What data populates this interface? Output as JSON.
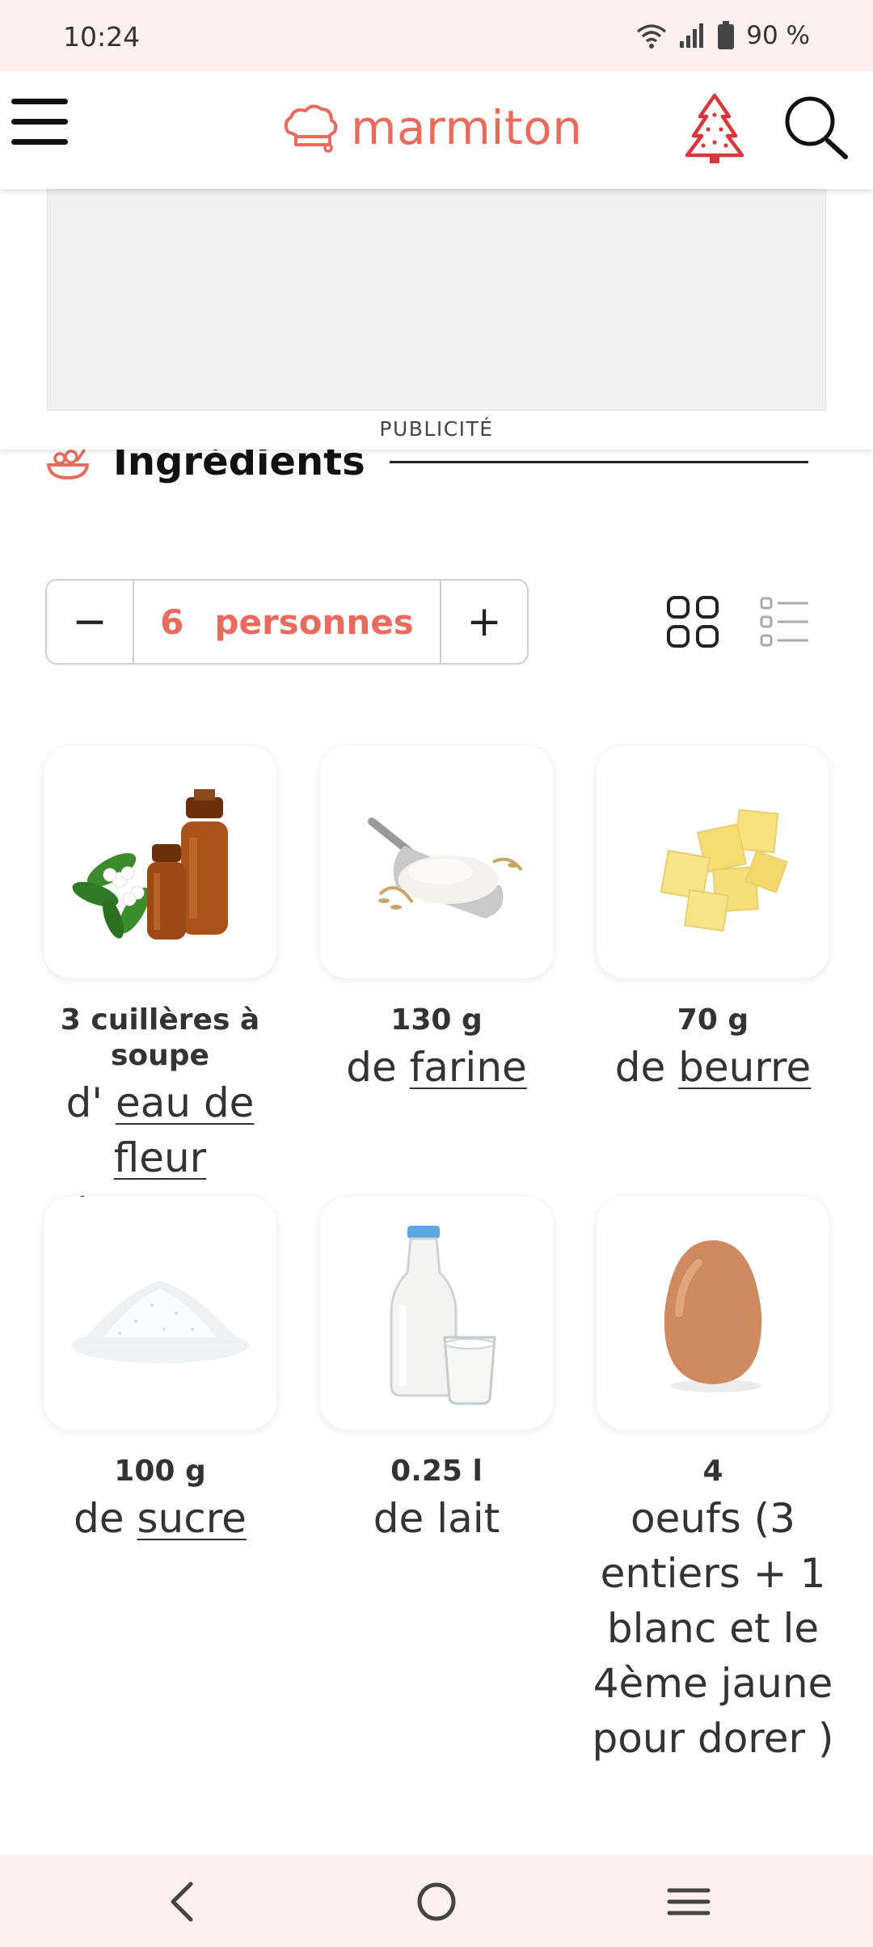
{
  "status_bar": {
    "time": "10:24",
    "battery": "90 %",
    "icons": [
      "wifi-icon",
      "signal-icon",
      "battery-icon"
    ]
  },
  "header": {
    "brand": "marmiton",
    "brand_color": "#e96b5e",
    "icons": [
      "menu-icon",
      "chef-hat-logo-icon",
      "christmas-tree-icon",
      "search-icon"
    ]
  },
  "ad": {
    "label": "PUBLICITÉ"
  },
  "section": {
    "title": "Ingrédients",
    "icon": "ingredients-bowl-icon"
  },
  "servings": {
    "minus": "−",
    "count": "6",
    "unit": "personnes",
    "plus": "+"
  },
  "view_toggle": {
    "icons": [
      "grid-view-icon",
      "list-view-icon"
    ]
  },
  "ingredients": [
    {
      "qty": "3 cuillères à soupe",
      "prefix": "d' ",
      "name": "eau de fleur d'oranger",
      "linked": true,
      "image": "orange-blossom-water-image"
    },
    {
      "qty": "130 g",
      "prefix": "de ",
      "name": "farine",
      "linked": true,
      "image": "flour-image"
    },
    {
      "qty": "70 g",
      "prefix": "de ",
      "name": "beurre",
      "linked": true,
      "image": "butter-image"
    },
    {
      "qty": "100 g",
      "prefix": "de ",
      "name": "sucre",
      "linked": true,
      "image": "sugar-image"
    },
    {
      "qty": "0.25 l",
      "prefix": "de ",
      "name": "lait",
      "linked": false,
      "image": "milk-image"
    },
    {
      "qty": "4",
      "prefix": "",
      "name": "oeufs (3 entiers + 1 blanc et le 4ème jaune pour dorer )",
      "linked": false,
      "image": "egg-image"
    }
  ],
  "nav_bar": {
    "icons": [
      "back-icon",
      "home-icon",
      "recents-icon"
    ]
  }
}
